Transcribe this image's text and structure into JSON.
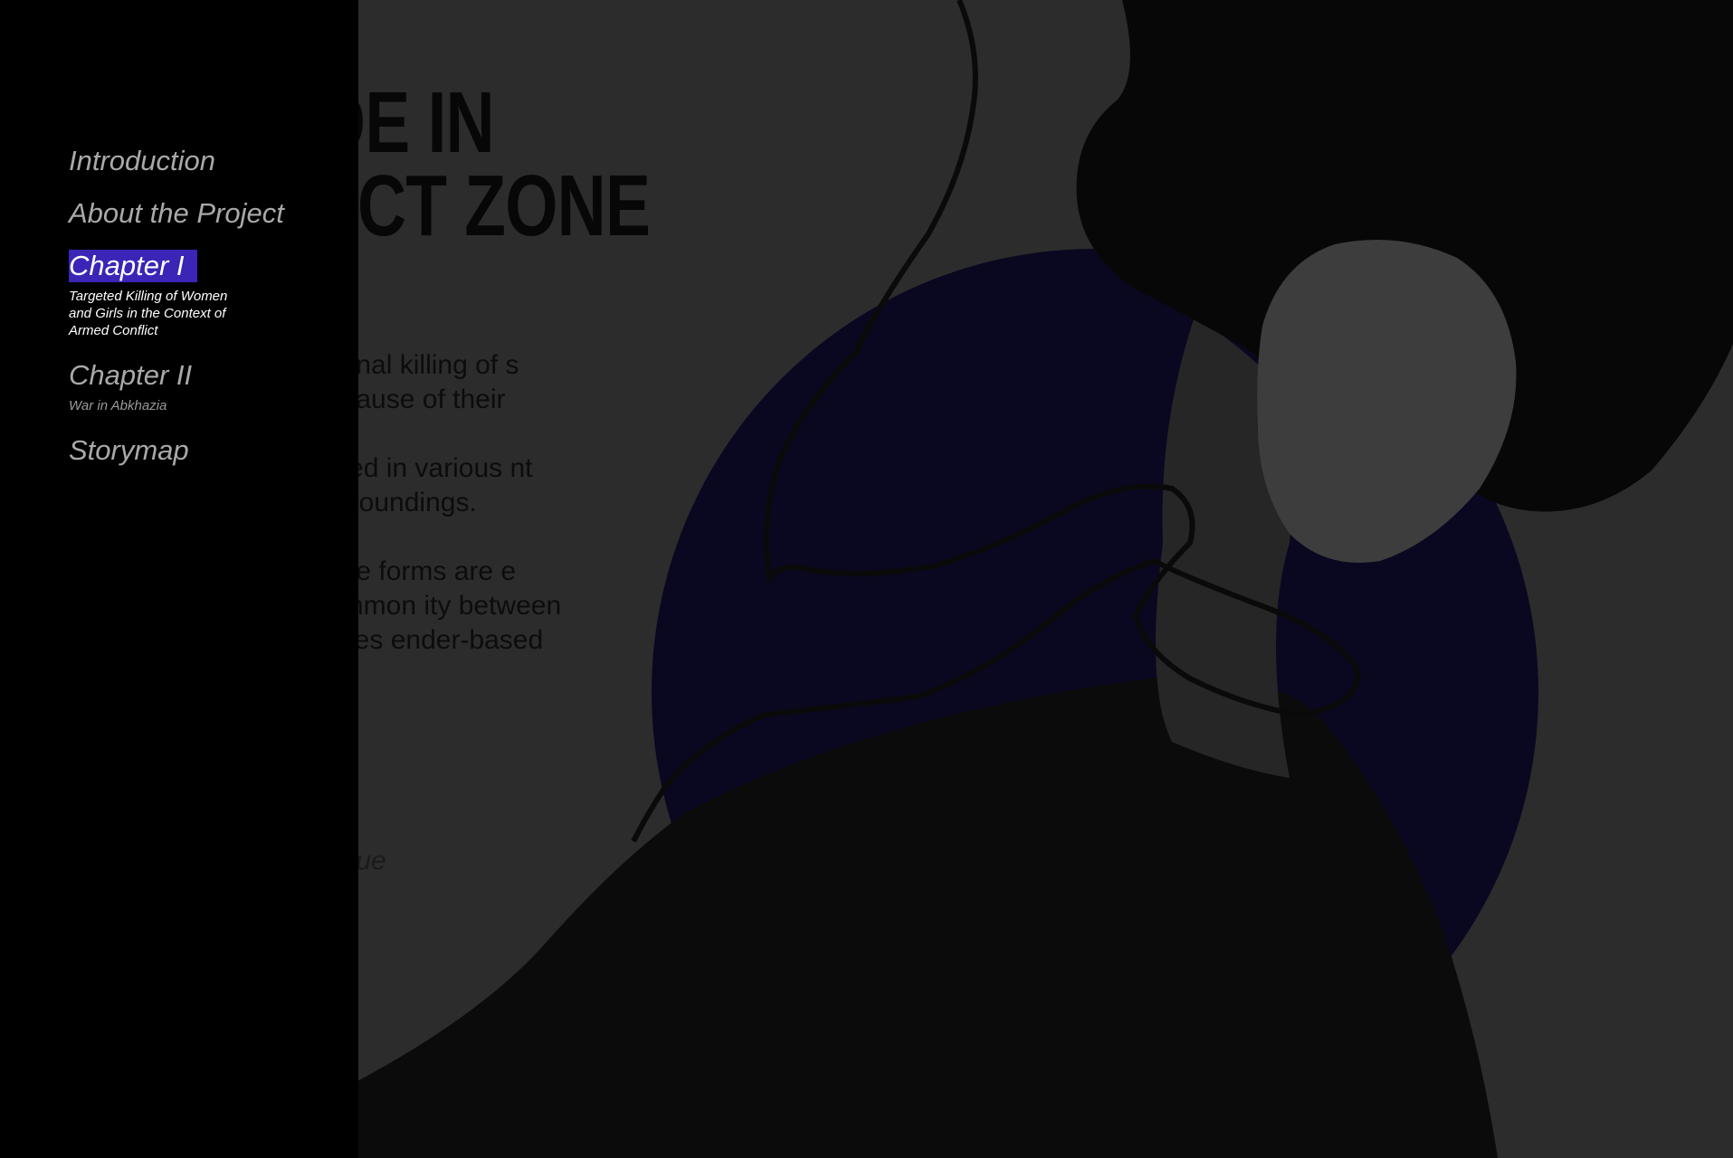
{
  "article": {
    "headline_line1": "IDE IN",
    "headline_line2": "LICT ZONE",
    "paragraphs": [
      "ntional killing of s because of their",
      "ealed in various nt surroundings.",
      "hese forms are e common ity between sexes ender-based"
    ],
    "continue_label": "ntinue"
  },
  "nav": {
    "items": [
      {
        "label": "Introduction",
        "subtitle": ""
      },
      {
        "label": "About the Project",
        "subtitle": ""
      },
      {
        "label": "Chapter I",
        "subtitle": "Targeted Killing of Women and Girls in the Context of Armed Conflict"
      },
      {
        "label": "Chapter II",
        "subtitle": "War in Abkhazia"
      },
      {
        "label": "Storymap",
        "subtitle": ""
      }
    ],
    "active_index": 2
  },
  "colors": {
    "background": "#2c2c2c",
    "nav_background": "#000000",
    "active_highlight": "#3a25b6",
    "circle": "#0a0820"
  }
}
